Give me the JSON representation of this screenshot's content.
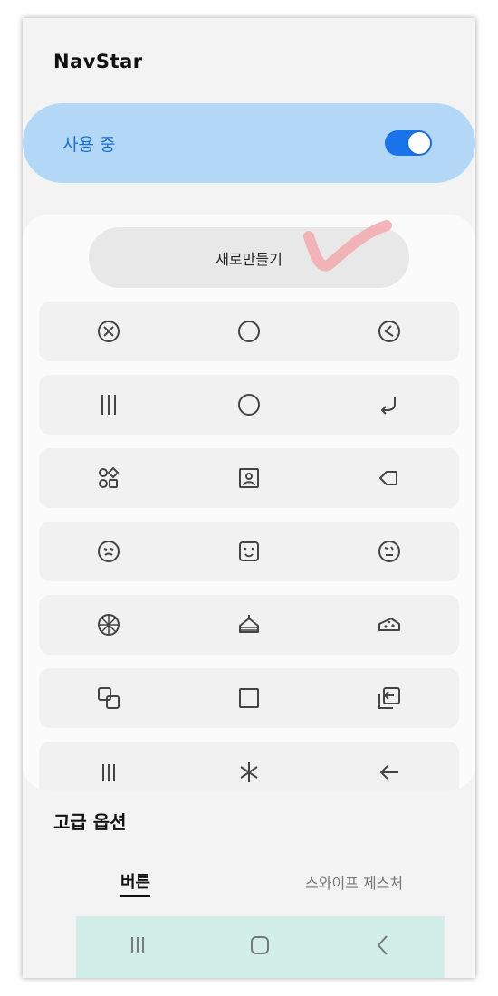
{
  "app": {
    "title": "NavStar"
  },
  "toggle": {
    "label": "사용 중",
    "state": "on",
    "color": "#1a73e8"
  },
  "create_button": {
    "label": "새로만들기"
  },
  "icon_rows": [
    [
      "circle-x-icon",
      "circle-icon",
      "circle-arrow-icon"
    ],
    [
      "three-bars-icon",
      "circle-icon",
      "return-arrow-icon"
    ],
    [
      "grid-shapes-icon",
      "portrait-frame-icon",
      "arrow-left-outline-icon"
    ],
    [
      "smiley-squint-icon",
      "square-smiley-icon",
      "smiley-wink-icon"
    ],
    [
      "pizza-icon",
      "cake-slice-icon",
      "cheese-icon"
    ],
    [
      "overlap-squares-icon",
      "square-icon",
      "enter-box-icon"
    ],
    [
      "thin-bars-icon",
      "asterisk-icon",
      "left-arrow-icon"
    ]
  ],
  "advanced": {
    "title": "고급 옵션"
  },
  "tabs": {
    "button": "버튼",
    "swipe": "스와이프 제스처",
    "selected": "버튼"
  },
  "navbar": {
    "recent": "recent-apps-icon",
    "home": "home-icon",
    "back": "back-icon",
    "color": "#d1efe8"
  }
}
